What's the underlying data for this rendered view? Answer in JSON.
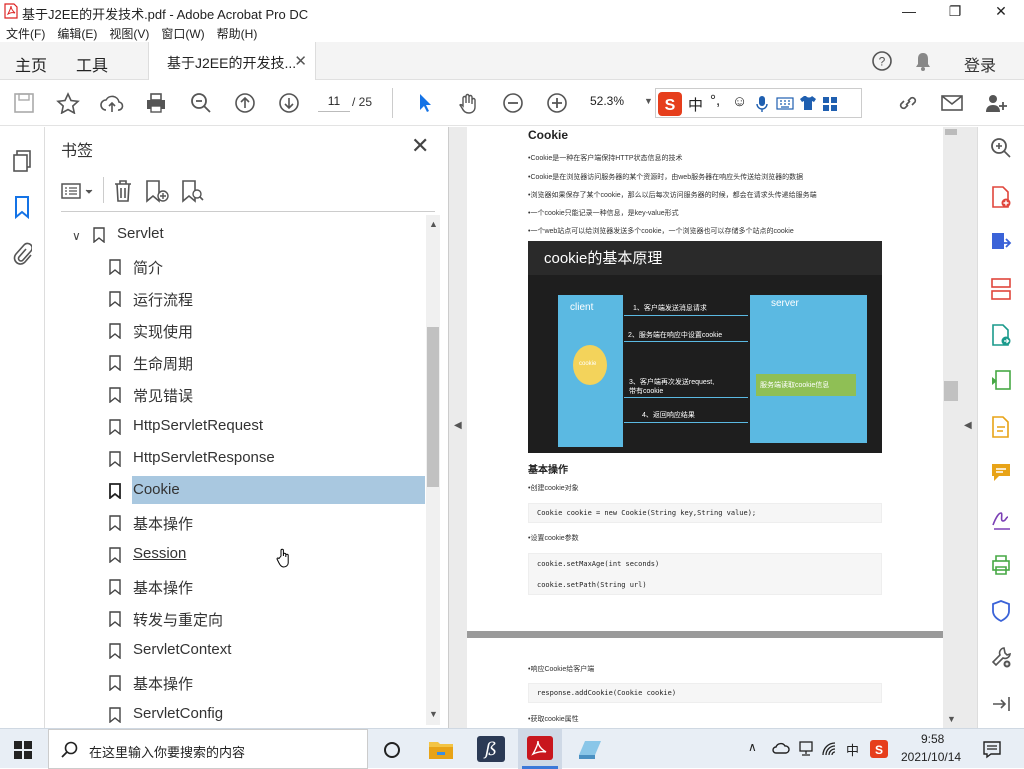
{
  "window": {
    "title": "基于J2EE的开发技术.pdf - Adobe Acrobat Pro DC"
  },
  "menu": [
    "文件(F)",
    "编辑(E)",
    "视图(V)",
    "窗口(W)",
    "帮助(H)"
  ],
  "tabs": {
    "home": "主页",
    "tools": "工具",
    "doc": "基于J2EE的开发技..."
  },
  "header": {
    "login": "登录"
  },
  "toolbar": {
    "page": "11",
    "total": "/ 25",
    "zoom": "52.3%"
  },
  "bookmarks": {
    "title": "书签",
    "items": [
      "Servlet",
      "简介",
      "运行流程",
      "实现使用",
      "生命周期",
      "常见错误",
      "HttpServletRequest",
      "HttpServletResponse",
      "Cookie",
      "基本操作",
      "Session",
      "基本操作",
      "转发与重定向",
      "ServletContext",
      "基本操作",
      "ServletConfig"
    ]
  },
  "doc": {
    "heading": "Cookie",
    "bullets": [
      "•Cookie是一种在客户端保持HTTP状态信息的技术",
      "•Cookie是在浏览器访问服务器的某个资源时，由web服务器在响应头传送给浏览器的数据",
      "•浏览器如果保存了某个cookie，那么以后每次访问服务器的时候，都会在请求头传递给服务端",
      "•一个cookie只能记录一种信息，是key-value形式",
      "•一个web站点可以给浏览器发送多个cookie，一个浏览器也可以存储多个站点的cookie"
    ],
    "diagram": {
      "title": "cookie的基本原理",
      "client": "client",
      "server": "server",
      "cookie": "cookie",
      "step1": "1、客户端发送消息请求",
      "step2": "2、服务端在响应中设置cookie",
      "step3a": "3、客户端再次发送request,",
      "step3b": "带有cookie",
      "step4": "4、返回响应结果",
      "serverbox": "服务端读取cookie信息"
    },
    "section": "基本操作",
    "b1": "•创建cookie对象",
    "code1": "Cookie cookie = new Cookie(String key,String value);",
    "b2": "•设置cookie参数",
    "code2a": "cookie.setMaxAge(int seconds)",
    "code2b": "cookie.setPath(String url)",
    "b3": "•响应Cookie给客户端",
    "code3": "response.addCookie(Cookie cookie)",
    "b4": "•获取cookie属性"
  },
  "taskbar": {
    "search": "在这里输入你要搜索的内容",
    "time": "9:58",
    "date": "2021/10/14",
    "ime": "中"
  },
  "colors": {
    "accent": "#1473e6",
    "selection": "#a9c8e0",
    "slide_bg": "#1e1e1e",
    "diagram_blue": "#5bb9e2"
  }
}
